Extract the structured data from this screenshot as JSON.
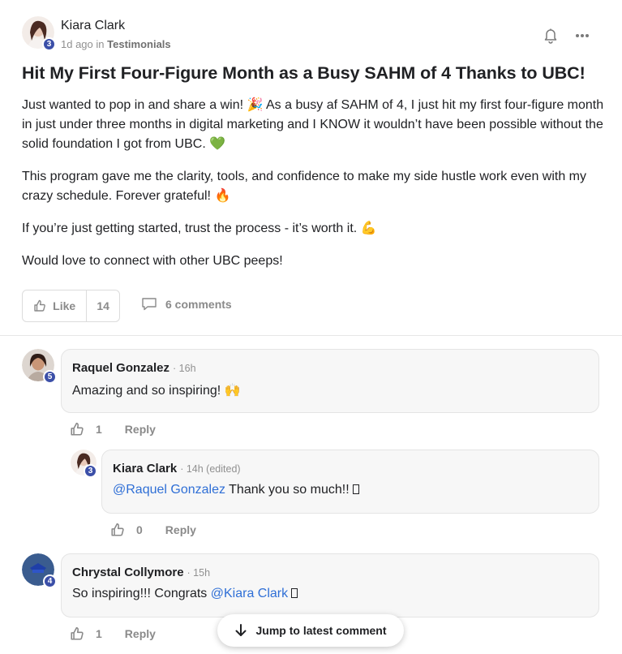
{
  "post": {
    "author": {
      "name": "Kiara Clark",
      "level": "3"
    },
    "meta": {
      "time": "1d ago",
      "in_word": "in",
      "category": "Testimonials"
    },
    "title": "Hit My First Four-Figure Month as a Busy SAHM of 4 Thanks to UBC!",
    "paragraphs": [
      {
        "text": "Just wanted to pop in and share a win! 🎉 As a busy af SAHM of 4, I just hit my first four-figure month in just under three months in digital marketing and I KNOW it wouldn’t have been possible without the solid foundation I got from UBC. 💚"
      },
      {
        "text": "This program gave me the clarity, tools, and confidence to make my side hustle work even with my crazy schedule. Forever grateful! 🔥"
      },
      {
        "text": "If you’re just getting started, trust the process - it’s worth it. 💪"
      },
      {
        "text": "Would love to connect with other UBC peeps!"
      }
    ],
    "like_label": "Like",
    "like_count": "14",
    "comments_label": "6 comments"
  },
  "comments": [
    {
      "name": "Raquel Gonzalez",
      "time": "· 16h",
      "level": "5",
      "text": "Amazing and so inspiring! 🙌",
      "likes": "1",
      "reply_label": "Reply"
    },
    {
      "name": "Kiara Clark",
      "time": "· 14h (edited)",
      "level": "3",
      "mention": "@Raquel Gonzalez",
      "text": " Thank you so much!!",
      "likes": "0",
      "reply_label": "Reply"
    },
    {
      "name": "Chrystal Collymore",
      "time": "· 15h",
      "level": "4",
      "text_before": "So inspiring!!! Congrats ",
      "mention": "@Kiara Clark",
      "likes": "1",
      "reply_label": "Reply"
    }
  ],
  "jump_label": "Jump to latest comment",
  "icons": [
    "bell-icon",
    "more-options-icon",
    "thumbs-up-icon",
    "comment-icon",
    "arrow-down-icon"
  ],
  "colors": {
    "level_badge": "#3b4fa8",
    "mention": "#2f6fd6",
    "bubble_bg": "#f7f7f7"
  }
}
